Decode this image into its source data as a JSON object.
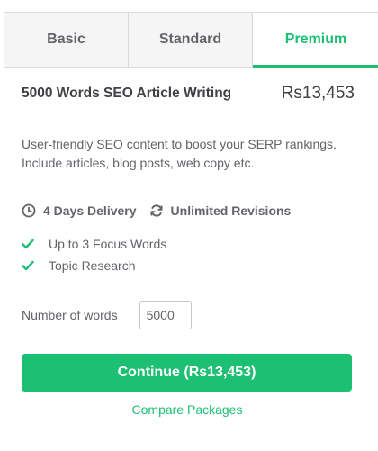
{
  "tabs": [
    {
      "label": "Basic",
      "active": false
    },
    {
      "label": "Standard",
      "active": false
    },
    {
      "label": "Premium",
      "active": true
    }
  ],
  "package": {
    "title": "5000 Words SEO Article Writing",
    "price": "Rs13,453",
    "description": "User-friendly SEO content to boost your SERP rankings. Include articles, blog posts, web copy etc.",
    "delivery": "4 Days Delivery",
    "revisions": "Unlimited Revisions",
    "features": [
      "Up to 3 Focus Words",
      "Topic Research"
    ]
  },
  "words": {
    "label": "Number of words",
    "value": "5000"
  },
  "actions": {
    "continue_label": "Continue (Rs13,453)",
    "compare_label": "Compare Packages"
  },
  "colors": {
    "accent": "#1dbf73",
    "text": "#404145",
    "muted": "#62646a",
    "border": "#dadbdd"
  },
  "icons": {
    "delivery": "clock-icon",
    "revisions": "refresh-icon",
    "feature": "check-icon"
  }
}
